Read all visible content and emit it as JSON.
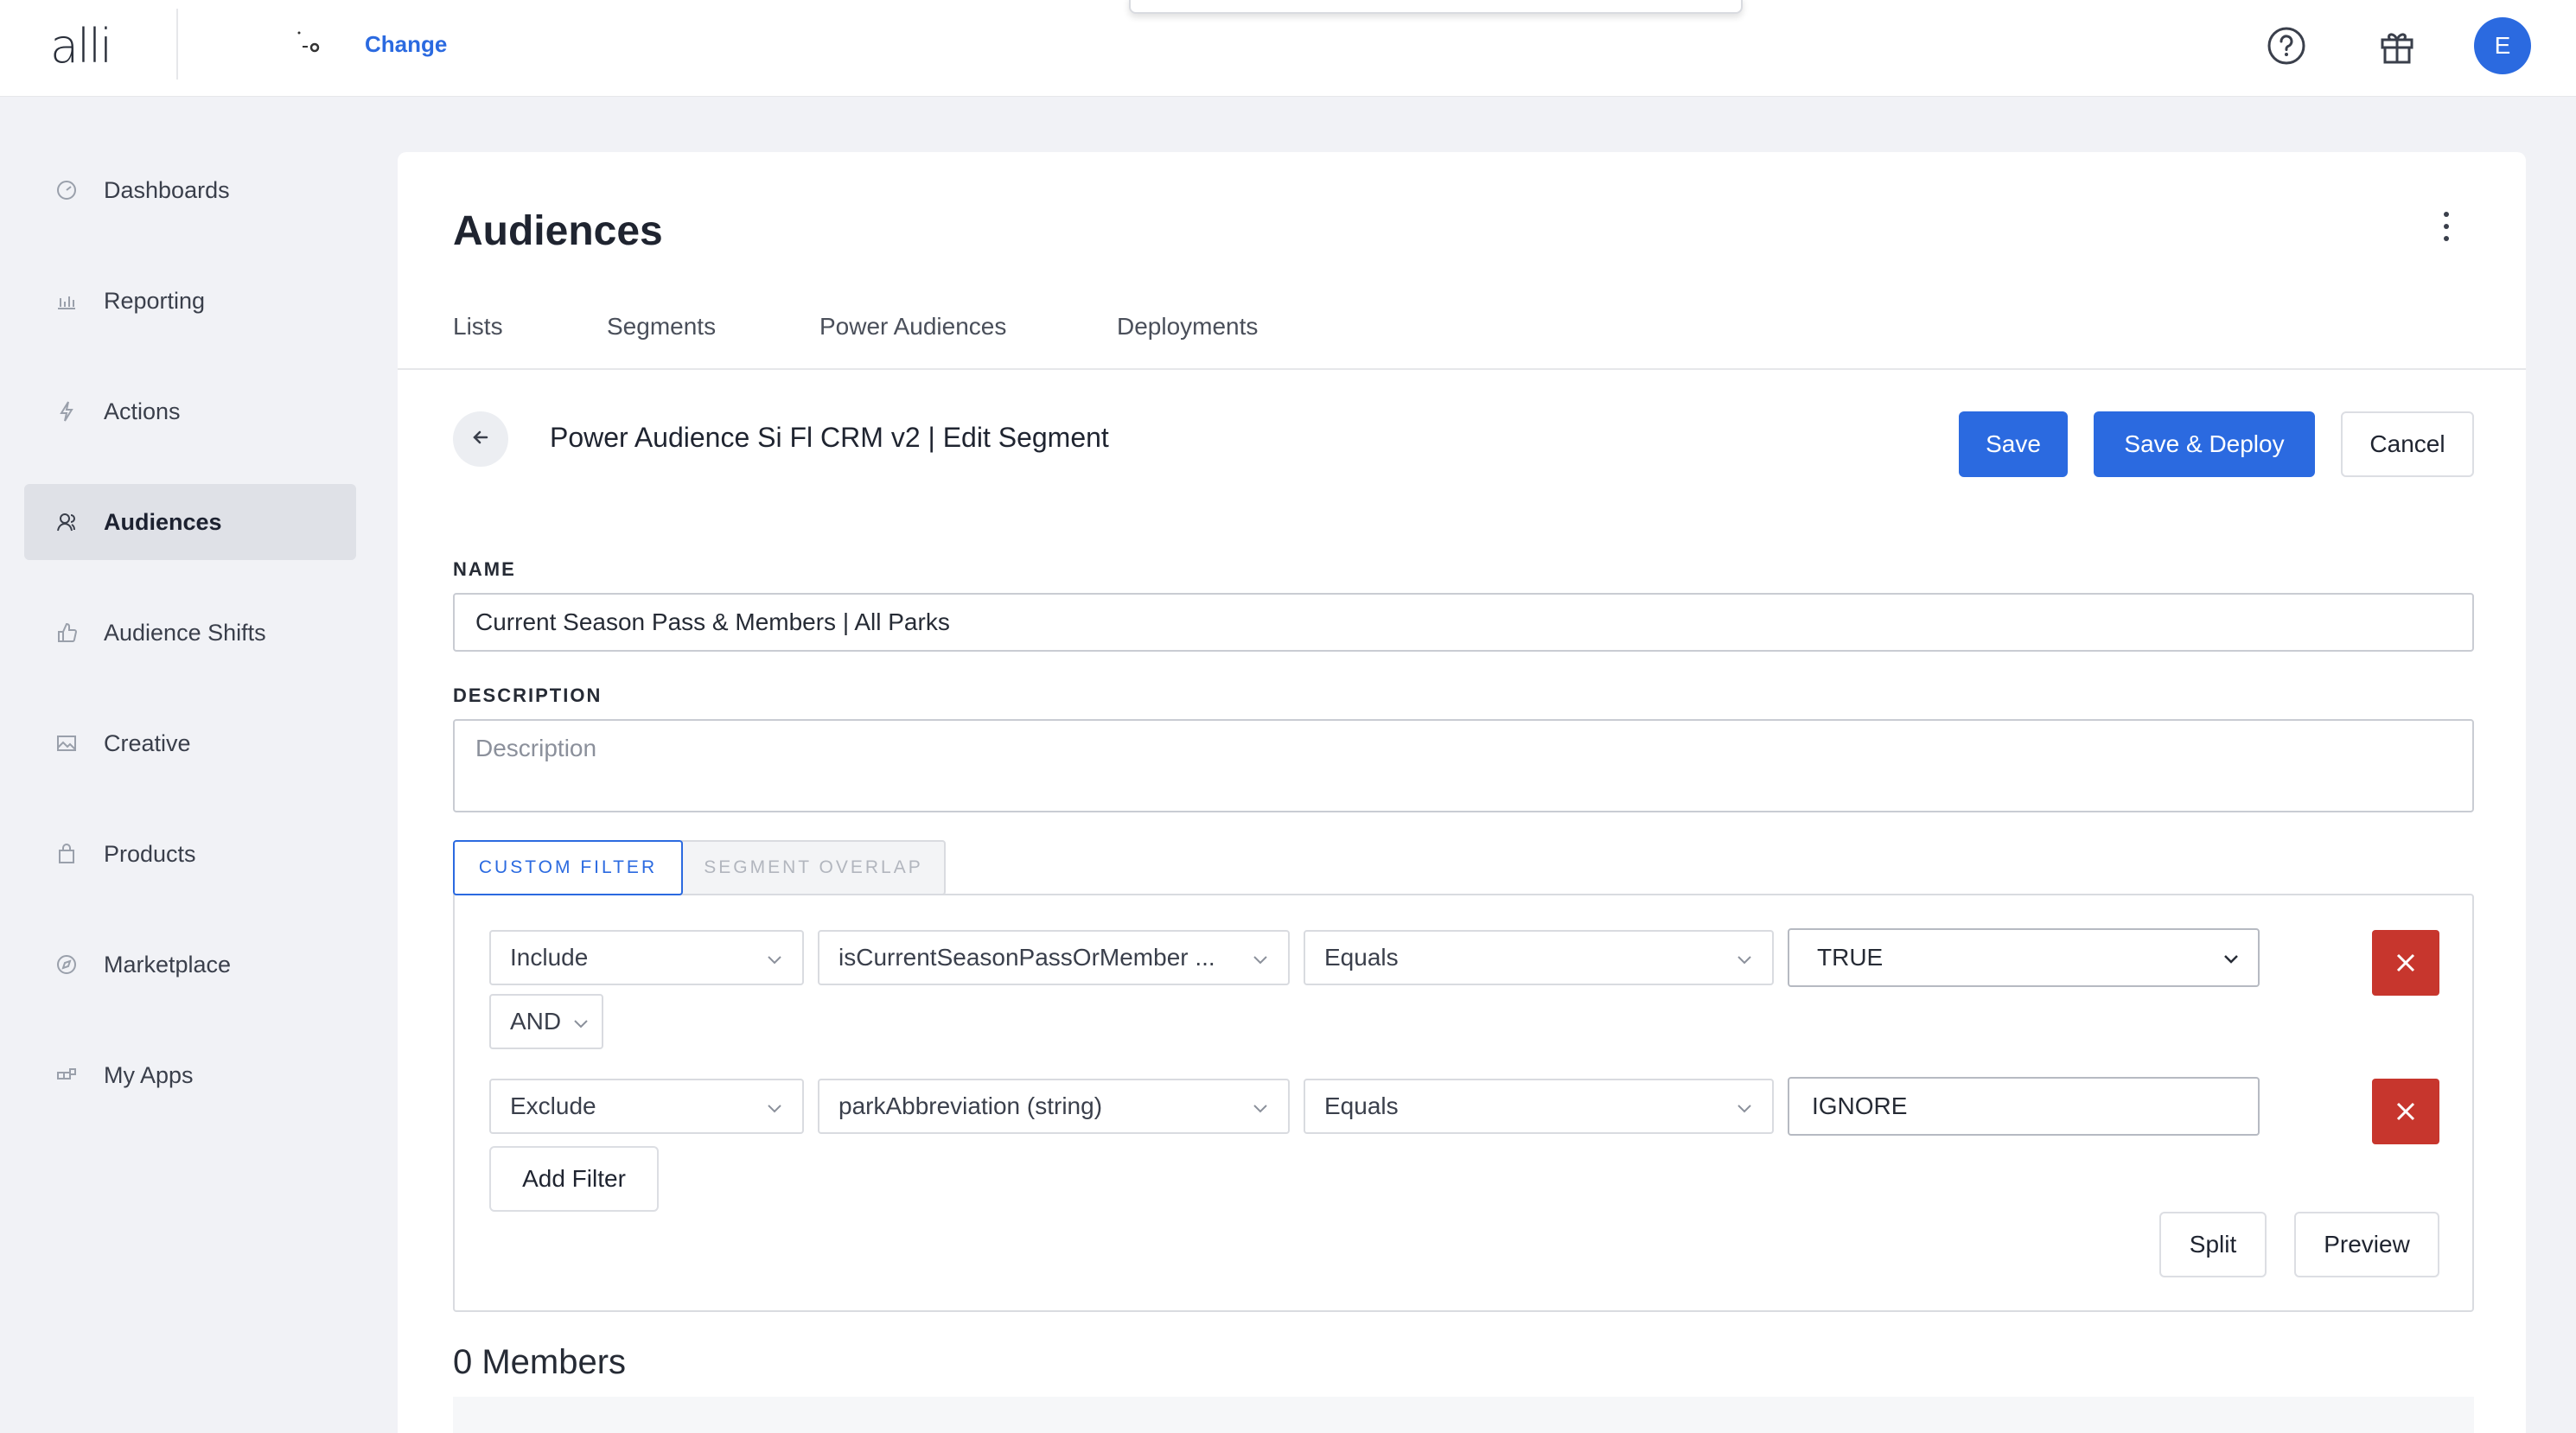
{
  "header": {
    "logo_text": "alli",
    "brand_mark": "~o",
    "change_label": "Change",
    "avatar_initial": "E",
    "help_icon": "help-circle-icon",
    "gift_icon": "gift-icon"
  },
  "sidebar": {
    "items": [
      {
        "label": "Dashboards",
        "icon": "gauge-icon"
      },
      {
        "label": "Reporting",
        "icon": "bar-chart-icon"
      },
      {
        "label": "Actions",
        "icon": "lightning-icon"
      },
      {
        "label": "Audiences",
        "icon": "users-icon",
        "active": true
      },
      {
        "label": "Audience Shifts",
        "icon": "thumbs-up-icon"
      },
      {
        "label": "Creative",
        "icon": "image-icon"
      },
      {
        "label": "Products",
        "icon": "shopping-bag-icon"
      },
      {
        "label": "Marketplace",
        "icon": "compass-icon"
      },
      {
        "label": "My Apps",
        "icon": "apps-icon"
      }
    ]
  },
  "main": {
    "title": "Audiences",
    "tabs": [
      "Lists",
      "Segments",
      "Power Audiences",
      "Deployments"
    ],
    "segment_title": "Power Audience Si  Fl    CRM v2 | Edit Segment",
    "buttons": {
      "save": "Save",
      "save_deploy": "Save & Deploy",
      "cancel": "Cancel"
    },
    "name_label": "NAME",
    "name_value": "Current Season Pass & Members | All Parks",
    "description_label": "DESCRIPTION",
    "description_placeholder": "Description",
    "filter_tabs": [
      "CUSTOM FILTER",
      "SEGMENT OVERLAP"
    ],
    "filters": [
      {
        "mode": "Include",
        "field": "isCurrentSeasonPassOrMember ...",
        "operator": "Equals",
        "value": "TRUE"
      },
      {
        "mode": "Exclude",
        "field": "parkAbbreviation (string)",
        "operator": "Equals",
        "value": "IGNORE"
      }
    ],
    "conjunction": "AND",
    "add_filter_label": "Add Filter",
    "split_label": "Split",
    "preview_label": "Preview",
    "members_label": "0 Members",
    "accent_color": "#2b6ae0",
    "danger_color": "#c7362d"
  }
}
